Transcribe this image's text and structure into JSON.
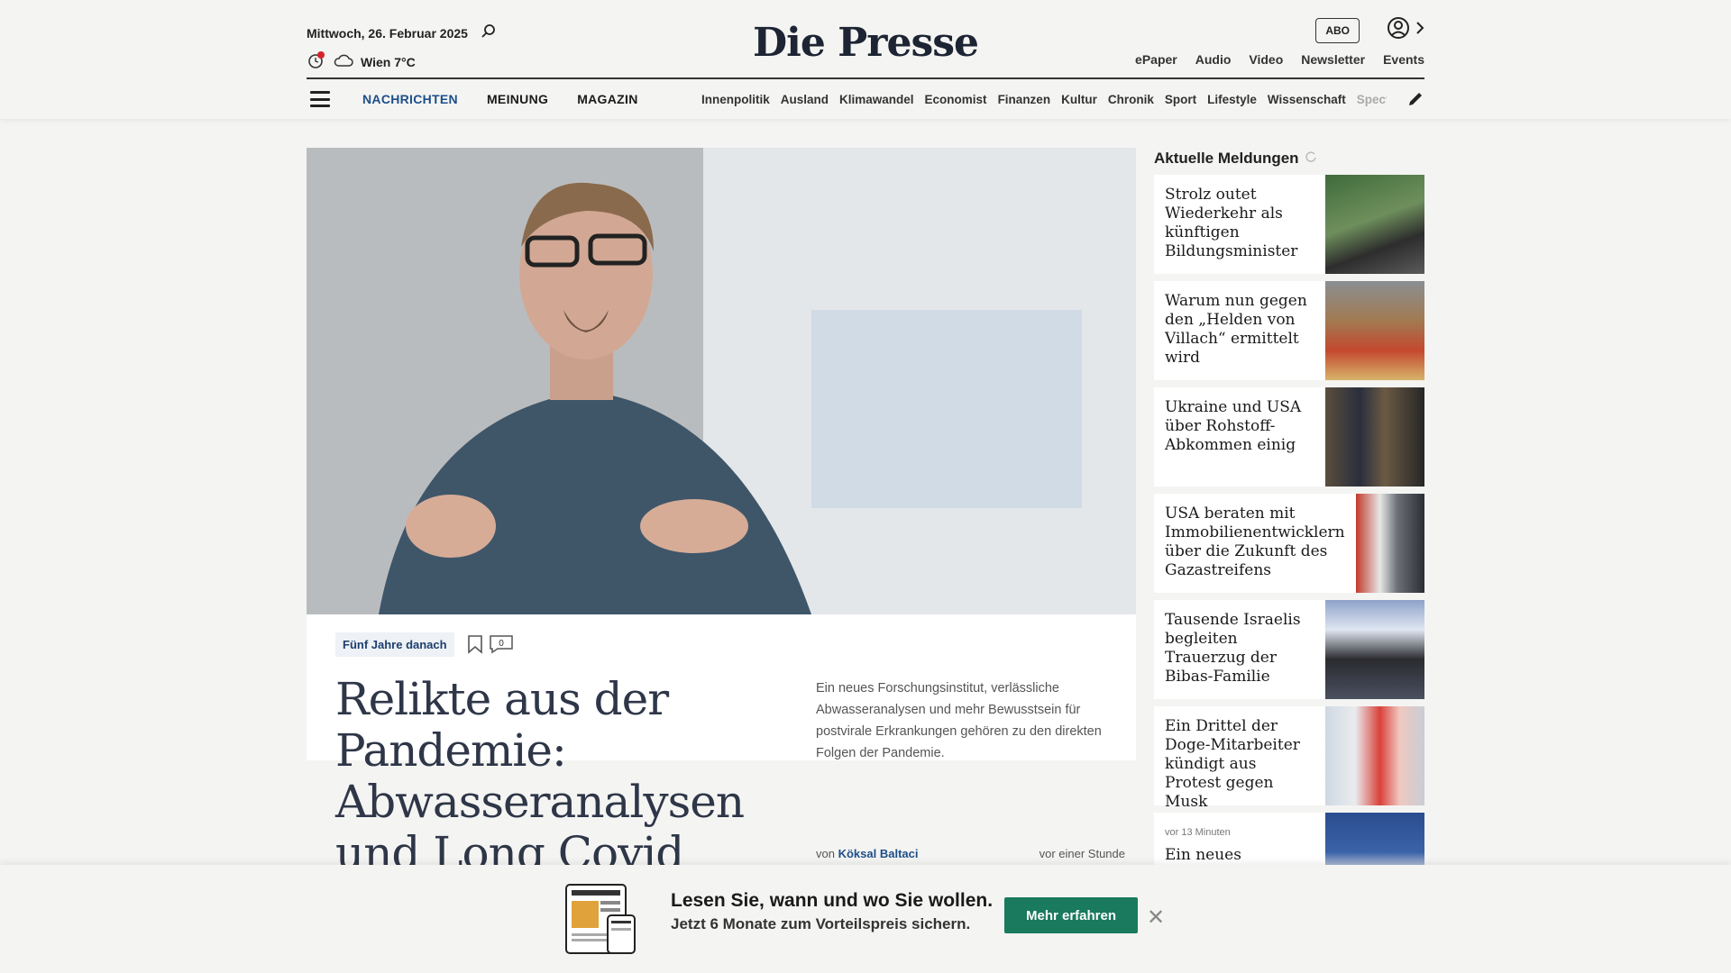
{
  "header": {
    "date": "Mittwoch, 26. Februar 2025",
    "weather": "Wien 7°C",
    "logo": "Die Presse",
    "abo": "ABO",
    "top_links": [
      "ePaper",
      "Audio",
      "Video",
      "Newsletter",
      "Events"
    ]
  },
  "nav": {
    "main": [
      "NACHRICHTEN",
      "MEINUNG",
      "MAGAZIN"
    ],
    "sub": [
      "Innenpolitik",
      "Ausland",
      "Klimawandel",
      "Economist",
      "Finanzen",
      "Kultur",
      "Chronik",
      "Sport",
      "Lifestyle",
      "Wissenschaft",
      "Spectr"
    ]
  },
  "hero": {
    "tag": "Fünf Jahre danach",
    "comment_count": "0",
    "headline": "Relikte aus der Pandemie: Abwasseranalysen und Long Covid",
    "teaser": "Ein neues Forschungsinstitut, verlässliche Abwasseranalysen und mehr Bewusstsein für postvirale Erkrankungen gehören zu den direkten Folgen der Pandemie.",
    "byline_prefix": "von",
    "author": "Köksal Baltaci",
    "time": "vor einer Stunde"
  },
  "sidebar": {
    "title": "Aktuelle Meldungen",
    "items": [
      {
        "title": "Strolz outet Wiederkehr als künftigen Bildungsminister"
      },
      {
        "title": "Warum nun gegen den „Helden von Villach“ ermittelt wird"
      },
      {
        "title": "Ukraine und USA über Rohstoff-Abkommen einig"
      },
      {
        "title": "USA beraten mit Immobilienentwicklern über die Zukunft des Gazastreifens"
      },
      {
        "title": "Tausende Israelis begleiten Trauerzug der Bibas-Familie"
      },
      {
        "title": "Ein Drittel der Doge-Mitarbeiter kündigt aus Protest gegen Musk"
      },
      {
        "meta": "vor 13 Minuten",
        "title": "Ein neues „breites“"
      }
    ]
  },
  "banner": {
    "line1": "Lesen Sie, wann und wo Sie wollen.",
    "line2": "Jetzt 6 Monate zum Vorteilspreis sichern.",
    "cta": "Mehr erfahren"
  }
}
